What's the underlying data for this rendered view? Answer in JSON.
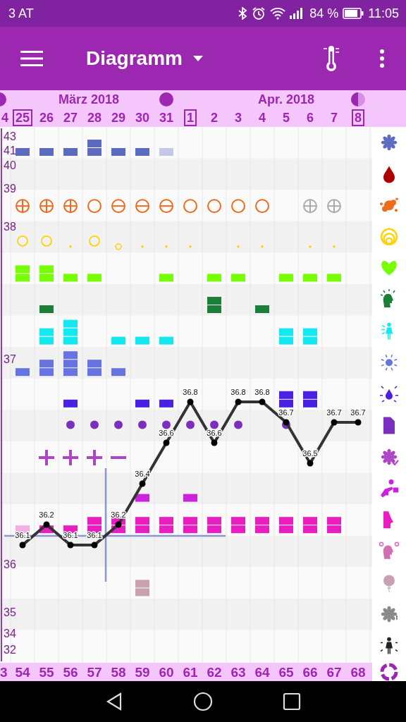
{
  "status_bar": {
    "carrier": "3 AT",
    "battery": "84 %",
    "time": "11:05"
  },
  "app_bar": {
    "title": "Diagramm"
  },
  "months": [
    {
      "label": "März 2018"
    },
    {
      "label": "Apr. 2018"
    }
  ],
  "dates": [
    {
      "label": "4",
      "boxed": false,
      "moon": {
        "kind": "full"
      }
    },
    {
      "label": "25",
      "boxed": true
    },
    {
      "label": "26",
      "boxed": false
    },
    {
      "label": "27",
      "boxed": false
    },
    {
      "label": "28",
      "boxed": false
    },
    {
      "label": "29",
      "boxed": false
    },
    {
      "label": "30",
      "boxed": false
    },
    {
      "label": "31",
      "boxed": false,
      "moon": {
        "kind": "full"
      }
    },
    {
      "label": "1",
      "boxed": true
    },
    {
      "label": "2",
      "boxed": false
    },
    {
      "label": "3",
      "boxed": false
    },
    {
      "label": "4",
      "boxed": false
    },
    {
      "label": "5",
      "boxed": false
    },
    {
      "label": "6",
      "boxed": false
    },
    {
      "label": "7",
      "boxed": false
    },
    {
      "label": "8",
      "boxed": true,
      "moon": {
        "kind": "half"
      }
    }
  ],
  "y_axis_labels": [
    "43",
    "41",
    "40",
    "39",
    "38",
    "37",
    "36",
    "35",
    "34",
    "32"
  ],
  "rows": [
    {
      "color": "#5c6bc0",
      "marks": [
        {
          "kind": "single"
        },
        {
          "kind": "single"
        },
        {
          "kind": "single"
        },
        {
          "kind": "double"
        },
        {
          "kind": "single"
        },
        {
          "kind": "single"
        },
        {
          "kind": "single-light"
        },
        {
          "kind": "blank"
        },
        {
          "kind": "blank"
        },
        {
          "kind": "blank"
        },
        {
          "kind": "blank"
        },
        {
          "kind": "blank"
        },
        {
          "kind": "blank"
        },
        {
          "kind": "blank"
        },
        {
          "kind": "blank"
        }
      ]
    },
    {
      "color": "#b00000"
    },
    {
      "color": "#ee6a1c",
      "marks": [
        {
          "kind": "plus"
        },
        {
          "kind": "plus"
        },
        {
          "kind": "plus"
        },
        {
          "kind": "circle"
        },
        {
          "kind": "minus"
        },
        {
          "kind": "minus"
        },
        {
          "kind": "minus"
        },
        {
          "kind": "circle"
        },
        {
          "kind": "circle"
        },
        {
          "kind": "circle"
        },
        {
          "kind": "circle"
        },
        {
          "kind": "blank"
        },
        {
          "kind": "plus-muted"
        },
        {
          "kind": "plus-muted"
        },
        {
          "kind": "blank"
        }
      ]
    },
    {
      "color": "#fdd20e",
      "marks": [
        {
          "kind": "ring"
        },
        {
          "kind": "ring"
        },
        {
          "kind": "dot"
        },
        {
          "kind": "ring"
        },
        {
          "kind": "ring-small"
        },
        {
          "kind": "dot"
        },
        {
          "kind": "dot"
        },
        {
          "kind": "dot"
        },
        {
          "kind": "blank"
        },
        {
          "kind": "dot"
        },
        {
          "kind": "dot"
        },
        {
          "kind": "blank"
        },
        {
          "kind": "dot"
        },
        {
          "kind": "dot"
        },
        {
          "kind": "blank"
        }
      ]
    },
    {
      "color": "#76ff03",
      "marks": [
        {
          "kind": "double"
        },
        {
          "kind": "double"
        },
        {
          "kind": "single"
        },
        {
          "kind": "single"
        },
        {
          "kind": "blank"
        },
        {
          "kind": "blank"
        },
        {
          "kind": "single"
        },
        {
          "kind": "blank"
        },
        {
          "kind": "single"
        },
        {
          "kind": "single"
        },
        {
          "kind": "blank"
        },
        {
          "kind": "single"
        },
        {
          "kind": "single"
        },
        {
          "kind": "single"
        },
        {
          "kind": "blank"
        }
      ]
    },
    {
      "color": "#1b7f3a",
      "marks": [
        {
          "kind": "blank"
        },
        {
          "kind": "single"
        },
        {
          "kind": "blank"
        },
        {
          "kind": "blank"
        },
        {
          "kind": "blank"
        },
        {
          "kind": "blank"
        },
        {
          "kind": "blank"
        },
        {
          "kind": "blank"
        },
        {
          "kind": "double"
        },
        {
          "kind": "blank"
        },
        {
          "kind": "single"
        },
        {
          "kind": "blank"
        },
        {
          "kind": "blank"
        },
        {
          "kind": "blank"
        },
        {
          "kind": "blank"
        }
      ]
    },
    {
      "color": "#14e8f0",
      "marks": [
        {
          "kind": "blank"
        },
        {
          "kind": "double"
        },
        {
          "kind": "triple"
        },
        {
          "kind": "blank"
        },
        {
          "kind": "single"
        },
        {
          "kind": "single"
        },
        {
          "kind": "single"
        },
        {
          "kind": "blank"
        },
        {
          "kind": "blank"
        },
        {
          "kind": "blank"
        },
        {
          "kind": "blank"
        },
        {
          "kind": "double"
        },
        {
          "kind": "double"
        },
        {
          "kind": "blank"
        },
        {
          "kind": "blank"
        }
      ]
    },
    {
      "color": "#6673e0",
      "marks": [
        {
          "kind": "single"
        },
        {
          "kind": "double"
        },
        {
          "kind": "triple"
        },
        {
          "kind": "double"
        },
        {
          "kind": "single"
        },
        {
          "kind": "blank"
        },
        {
          "kind": "blank"
        },
        {
          "kind": "blank"
        },
        {
          "kind": "blank"
        },
        {
          "kind": "blank"
        },
        {
          "kind": "blank"
        },
        {
          "kind": "blank"
        },
        {
          "kind": "blank"
        },
        {
          "kind": "blank"
        },
        {
          "kind": "blank"
        }
      ]
    },
    {
      "color": "#4a1fe6",
      "marks": [
        {
          "kind": "blank"
        },
        {
          "kind": "blank"
        },
        {
          "kind": "single"
        },
        {
          "kind": "blank"
        },
        {
          "kind": "blank"
        },
        {
          "kind": "single"
        },
        {
          "kind": "single"
        },
        {
          "kind": "blank"
        },
        {
          "kind": "blank"
        },
        {
          "kind": "blank"
        },
        {
          "kind": "blank"
        },
        {
          "kind": "double"
        },
        {
          "kind": "double"
        },
        {
          "kind": "blank"
        },
        {
          "kind": "blank"
        }
      ]
    },
    {
      "color": "#7b2fbf",
      "marks": [
        {
          "kind": "blank"
        },
        {
          "kind": "blank"
        },
        {
          "kind": "dot-large"
        },
        {
          "kind": "dot-large"
        },
        {
          "kind": "dot-large"
        },
        {
          "kind": "dot-large"
        },
        {
          "kind": "dot-large"
        },
        {
          "kind": "dot-large"
        },
        {
          "kind": "dot-large"
        },
        {
          "kind": "dot-large"
        },
        {
          "kind": "blank"
        },
        {
          "kind": "dot-large"
        },
        {
          "kind": "blank"
        },
        {
          "kind": "blank"
        },
        {
          "kind": "blank"
        }
      ]
    },
    {
      "color": "#ad45c4",
      "marks": [
        {
          "kind": "blank"
        },
        {
          "kind": "bold-plus"
        },
        {
          "kind": "bold-plus"
        },
        {
          "kind": "bold-plus"
        },
        {
          "kind": "bold-minus"
        },
        {
          "kind": "blank"
        },
        {
          "kind": "blank"
        },
        {
          "kind": "blank"
        },
        {
          "kind": "blank"
        },
        {
          "kind": "blank"
        },
        {
          "kind": "blank"
        },
        {
          "kind": "blank"
        },
        {
          "kind": "blank"
        },
        {
          "kind": "blank"
        },
        {
          "kind": "blank"
        }
      ]
    },
    {
      "color": "#cc22dd",
      "marks": [
        {
          "kind": "blank"
        },
        {
          "kind": "blank"
        },
        {
          "kind": "blank"
        },
        {
          "kind": "blank"
        },
        {
          "kind": "blank"
        },
        {
          "kind": "single"
        },
        {
          "kind": "blank"
        },
        {
          "kind": "single"
        },
        {
          "kind": "blank"
        },
        {
          "kind": "blank"
        },
        {
          "kind": "blank"
        },
        {
          "kind": "blank"
        },
        {
          "kind": "blank"
        },
        {
          "kind": "blank"
        },
        {
          "kind": "blank"
        }
      ]
    },
    {
      "color": "#e81ec0",
      "marks": [
        {
          "kind": "single-light"
        },
        {
          "kind": "single"
        },
        {
          "kind": "single"
        },
        {
          "kind": "double"
        },
        {
          "kind": "double"
        },
        {
          "kind": "double"
        },
        {
          "kind": "double"
        },
        {
          "kind": "double"
        },
        {
          "kind": "double"
        },
        {
          "kind": "double"
        },
        {
          "kind": "double"
        },
        {
          "kind": "double"
        },
        {
          "kind": "double"
        },
        {
          "kind": "double"
        },
        {
          "kind": "blank"
        }
      ]
    },
    {
      "color": "#d070b0"
    },
    {
      "color": "#c9a0b0",
      "marks": [
        {
          "kind": "blank"
        },
        {
          "kind": "blank"
        },
        {
          "kind": "blank"
        },
        {
          "kind": "blank"
        },
        {
          "kind": "blank"
        },
        {
          "kind": "double"
        },
        {
          "kind": "blank"
        },
        {
          "kind": "blank"
        },
        {
          "kind": "blank"
        },
        {
          "kind": "blank"
        },
        {
          "kind": "blank"
        },
        {
          "kind": "blank"
        },
        {
          "kind": "blank"
        },
        {
          "kind": "blank"
        },
        {
          "kind": "blank"
        }
      ]
    },
    {
      "color": "#888888"
    },
    {
      "color": "#222222"
    }
  ],
  "chart_data": {
    "type": "line",
    "categories": [
      "3",
      "54",
      "55",
      "56",
      "57",
      "58",
      "59",
      "60",
      "61",
      "62",
      "63",
      "64",
      "65",
      "66",
      "67",
      "68"
    ],
    "series": [
      {
        "color": "#333333",
        "marker": "circle",
        "values": [
          null,
          36.1,
          36.2,
          36.1,
          36.1,
          36.2,
          36.4,
          36.6,
          36.8,
          36.6,
          36.8,
          36.8,
          36.7,
          36.5,
          36.7,
          36.7
        ]
      }
    ],
    "data_labels": true
  }
}
